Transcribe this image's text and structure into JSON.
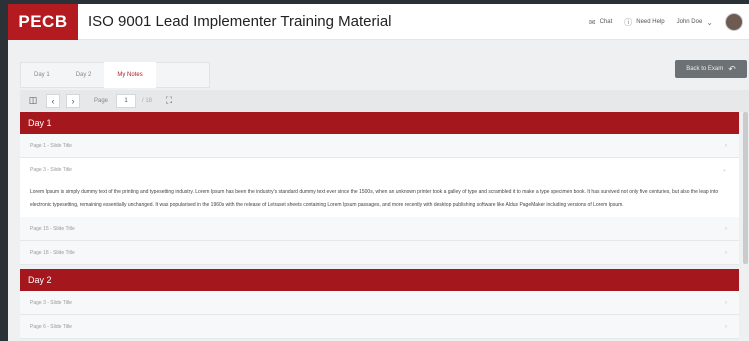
{
  "header": {
    "logo": "PECB",
    "title": "ISO 9001 Lead Implementer Training Material",
    "chat_label": "Chat",
    "help_label": "Need Help",
    "user_name": "John Doe"
  },
  "tabs": [
    {
      "label": "Day 1",
      "active": false
    },
    {
      "label": "Day 2",
      "active": false
    },
    {
      "label": "My Notes",
      "active": true
    }
  ],
  "back_button": "Back to Exam",
  "toolbar": {
    "page_label": "Page",
    "page_value": "1",
    "page_total": "/ 18"
  },
  "days": [
    {
      "title": "Day 1",
      "pages": [
        {
          "title": "Page 1 - Slide Title",
          "expanded": false
        },
        {
          "title": "Page 3 - Slide Title",
          "expanded": true,
          "note": "Lorem Ipsum is simply dummy text of the printing and typesetting industry. Lorem Ipsum has been the industry's standard dummy text ever since the 1500s, when an unknown printer took a galley of type and scrambled it to make a type specimen book. It has survived not only five centuries, but also the leap into electronic typesetting, remaining essentially unchanged. It was popularised in the 1960s with the release of Letraset sheets containing Lorem Ipsum passages, and more recently with desktop publishing software like Aldus PageMaker including versions of Lorem Ipsum."
        },
        {
          "title": "Page 15 - Slide Title",
          "expanded": false
        },
        {
          "title": "Page 18 - Slide Title",
          "expanded": false
        }
      ]
    },
    {
      "title": "Day 2",
      "pages": [
        {
          "title": "Page 3 - Slide Title",
          "expanded": false
        },
        {
          "title": "Page 6 - Slide Title",
          "expanded": false
        }
      ]
    }
  ],
  "colors": {
    "brand": "#b31b21",
    "day_header": "#a4171d"
  }
}
